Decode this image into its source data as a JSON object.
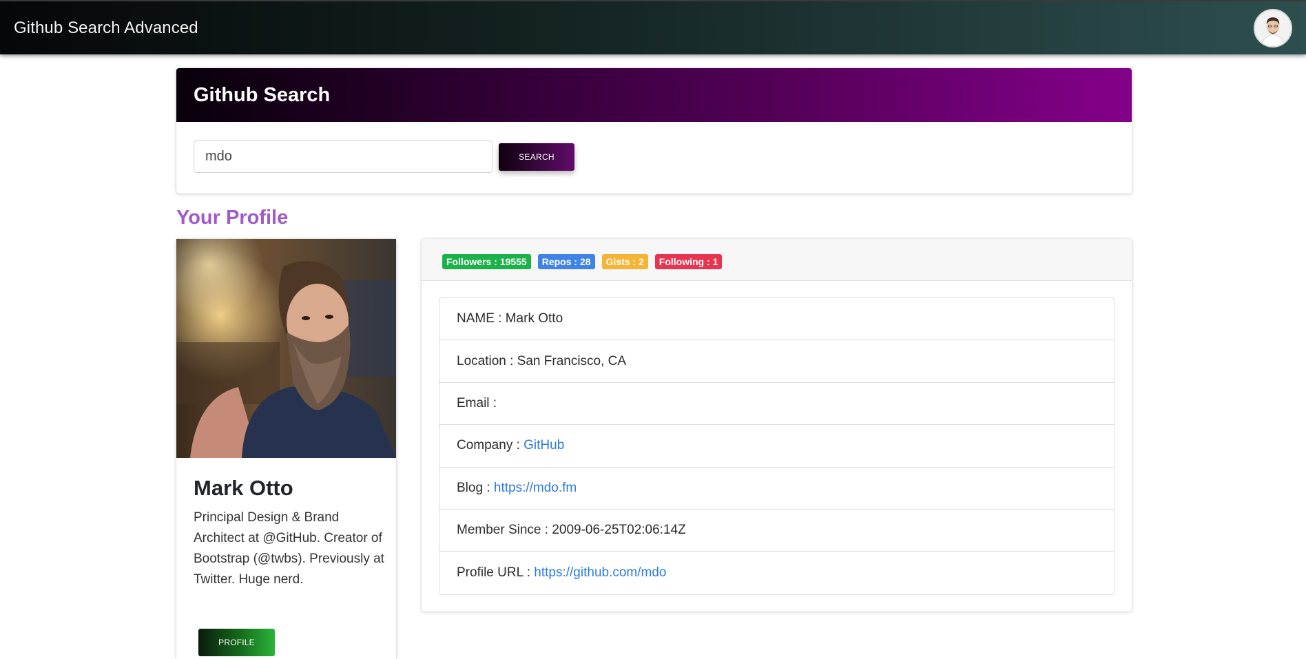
{
  "navbar": {
    "brand": "Github Search Advanced",
    "avatar_icon": "user-avatar"
  },
  "search": {
    "title": "Github Search",
    "input_value": "mdo",
    "button_label": "SEARCH"
  },
  "profile": {
    "heading": "Your Profile",
    "name": "Mark Otto",
    "bio": "Principal Design & Brand Architect at @GitHub. Creator of Bootstrap (@twbs). Previously at Twitter. Huge nerd.",
    "button_label": "PROFILE"
  },
  "stats": {
    "followers": "Followers : 19555",
    "repos": "Repos : 28",
    "gists": "Gists : 2",
    "following": "Following : 1"
  },
  "details": {
    "name_label": "NAME : ",
    "name_value": "Mark Otto",
    "location_label": "Location : ",
    "location_value": "San Francisco, CA",
    "email_label": "Email : ",
    "email_value": "",
    "company_label": "Company : ",
    "company_value": "GitHub",
    "blog_label": "Blog : ",
    "blog_value": "https://mdo.fm",
    "member_label": "Member Since : ",
    "member_value": "2009-06-25T02:06:14Z",
    "url_label": "Profile URL : ",
    "url_value": "https://github.com/mdo"
  },
  "colors": {
    "navbar_start": "#050708",
    "navbar_end": "#2e4f4f",
    "search_header_start": "#08000a",
    "search_header_end": "#84008a",
    "profile_heading": "#a259c8",
    "link": "#2a7ae2",
    "followers_badge": "#1cb24a",
    "repos_badge": "#3f83e6",
    "gists_badge": "#f5b434",
    "following_badge": "#e8344f",
    "profile_button": "#2bb53a"
  }
}
